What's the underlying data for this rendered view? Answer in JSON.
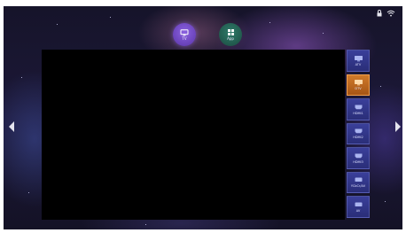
{
  "top_apps": [
    {
      "label": "TV",
      "icon": "tv-icon"
    },
    {
      "label": "App",
      "icon": "grid-icon"
    }
  ],
  "status_icons": [
    "lock-icon",
    "wifi-icon"
  ],
  "sources": [
    {
      "label": "ATV",
      "active": false
    },
    {
      "label": "DTV",
      "active": true
    },
    {
      "label": "HDMI1",
      "active": false
    },
    {
      "label": "HDMI2",
      "active": false
    },
    {
      "label": "HDMI3",
      "active": false
    },
    {
      "label": "YCbCr/AV",
      "active": false
    },
    {
      "label": "AV",
      "active": false
    }
  ],
  "colors": {
    "active_source": "#c8691f",
    "source_bg": "#33388a",
    "tv_button": "#7a52d0",
    "app_button": "#2a6b5c"
  },
  "nav": [
    "left-arrow-icon",
    "right-arrow-icon"
  ]
}
